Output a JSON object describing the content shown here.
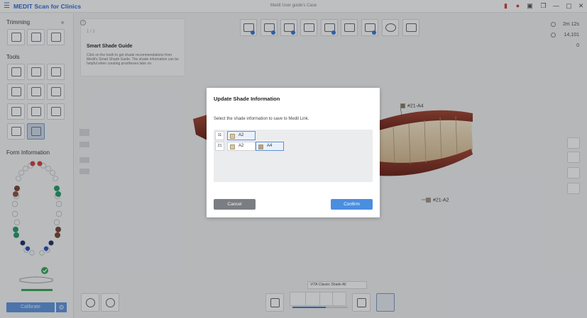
{
  "app": {
    "name": "MEDIT Scan for Clinics",
    "document_title": "Medit User guide's Case"
  },
  "left_panel": {
    "trimming_title": "Trimming",
    "tools_title": "Tools",
    "form_info_title": "Form Information",
    "calibrate_label": "Calibrate"
  },
  "shade_guide": {
    "nav_label": "1 / 1",
    "title": "Smart Shade Guide",
    "description": "Click on the tooth to get shade recommendations from Medit's Smart Shade Guide. The shade information can be helpful when creating prostheses later on."
  },
  "stats": {
    "time": "2m 12s",
    "count": "14,101",
    "zero": "0"
  },
  "shade_labels": {
    "upper": "#21-A4",
    "lower": "#21-A2"
  },
  "dialog": {
    "title": "Update Shade Information",
    "message": "Select the shade information to save to Medit Link.",
    "rows": [
      {
        "tooth": "11",
        "shades": [
          "A2"
        ]
      },
      {
        "tooth": "21",
        "shades": [
          "A2",
          "A4"
        ]
      }
    ],
    "cancel_label": "Cancel",
    "confirm_label": "Confirm"
  },
  "bottom": {
    "context_label": "VITA Classic Shade All",
    "slider_fraction": 0.6
  },
  "colors": {
    "accent": "#3a7bd5",
    "shade_swatch": "#d9c9a2"
  }
}
